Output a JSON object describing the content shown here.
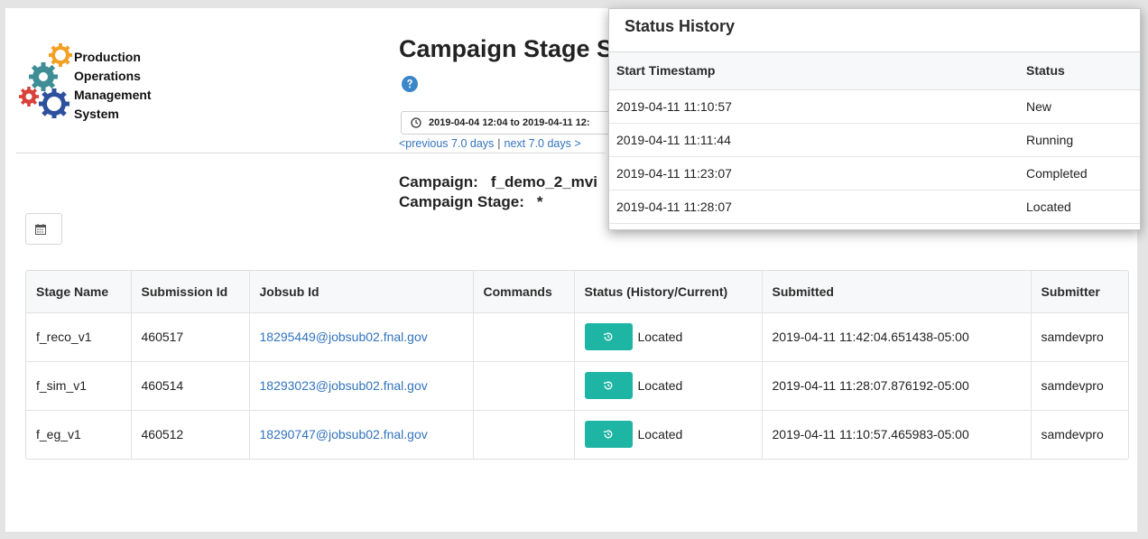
{
  "logo": {
    "lines": [
      "Production",
      "Operations",
      "Management",
      "System"
    ]
  },
  "title": "Campaign Stage Su",
  "date_range": "2019-04-04 12:04 to 2019-04-11 12:",
  "nav": {
    "previous": "<previous 7.0 days",
    "separator": "|",
    "next": "next 7.0 days >"
  },
  "campaign": {
    "campaign_label": "Campaign:",
    "campaign_value": "f_demo_2_mvi",
    "stage_label": "Campaign Stage:",
    "stage_value": "*"
  },
  "table": {
    "headers": [
      "Stage Name",
      "Submission Id",
      "Jobsub Id",
      "Commands",
      "Status (History/Current)",
      "Submitted",
      "Submitter"
    ],
    "rows": [
      {
        "stage": "f_reco_v1",
        "submission_id": "460517",
        "jobsub_id": "18295449@jobsub02.fnal.gov",
        "commands": "",
        "status": "Located",
        "submitted": "2019-04-11 11:42:04.651438-05:00",
        "submitter": "samdevpro"
      },
      {
        "stage": "f_sim_v1",
        "submission_id": "460514",
        "jobsub_id": "18293023@jobsub02.fnal.gov",
        "commands": "",
        "status": "Located",
        "submitted": "2019-04-11 11:28:07.876192-05:00",
        "submitter": "samdevpro"
      },
      {
        "stage": "f_eg_v1",
        "submission_id": "460512",
        "jobsub_id": "18290747@jobsub02.fnal.gov",
        "commands": "",
        "status": "Located",
        "submitted": "2019-04-11 11:10:57.465983-05:00",
        "submitter": "samdevpro"
      }
    ]
  },
  "popup": {
    "title": "Status History",
    "headers": [
      "Start Timestamp",
      "Status"
    ],
    "rows": [
      {
        "timestamp": "2019-04-11 11:10:57",
        "status": "New"
      },
      {
        "timestamp": "2019-04-11 11:11:44",
        "status": "Running"
      },
      {
        "timestamp": "2019-04-11 11:23:07",
        "status": "Completed"
      },
      {
        "timestamp": "2019-04-11 11:28:07",
        "status": "Located"
      }
    ]
  },
  "colors": {
    "accent_teal": "#1fb5a4",
    "link_blue": "#3273bd",
    "help_blue": "#3b86c8"
  },
  "icons": {
    "help": "question-circle-icon",
    "clock": "clock-icon",
    "calendar": "calendar-icon",
    "history": "history-icon"
  }
}
